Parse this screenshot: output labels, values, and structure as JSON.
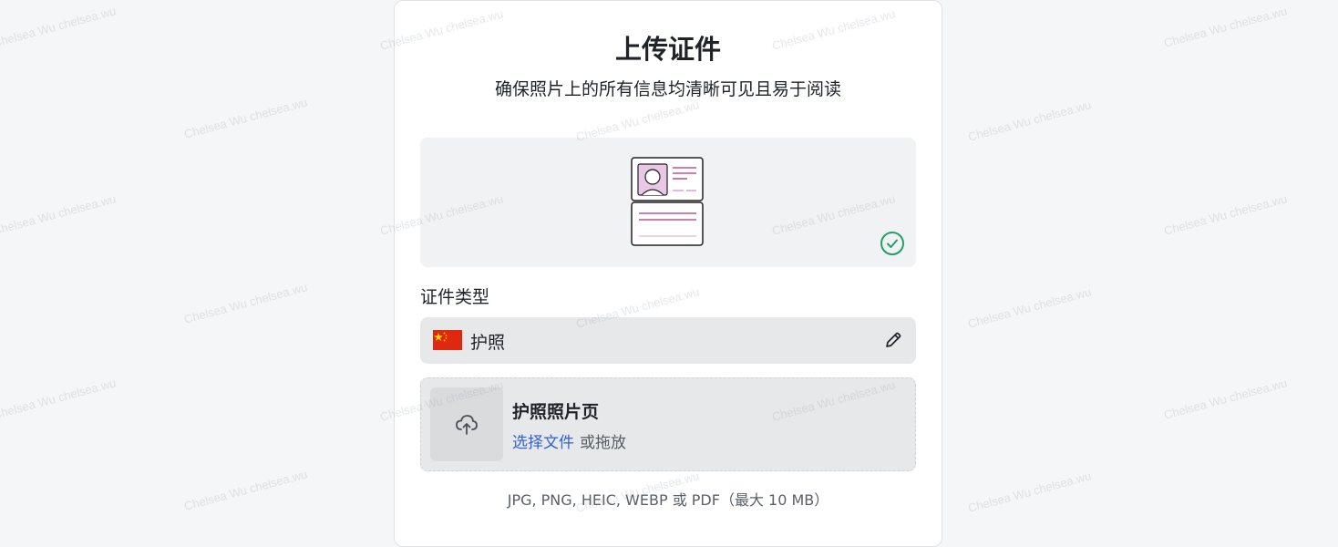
{
  "page": {
    "title": "上传证件",
    "subtitle": "确保照片上的所有信息均清晰可见且易于阅读"
  },
  "preview": {
    "illustration_icon": "id-card-icon",
    "status_icon": "check-circle-icon",
    "status_color": "#22a06b"
  },
  "document_type": {
    "label": "证件类型",
    "value": "护照",
    "flag_icon": "china-flag-icon",
    "edit_icon": "pencil-icon"
  },
  "upload": {
    "title": "护照照片页",
    "choose_file": "选择文件",
    "or_drag": "或拖放",
    "upload_icon": "cloud-upload-icon",
    "link_color": "#2f62d8"
  },
  "formats_text": "JPG, PNG, HEIC, WEBP 或 PDF（最大 10 MB）",
  "watermark_text": "Chelsea Wu chelsea.wu"
}
